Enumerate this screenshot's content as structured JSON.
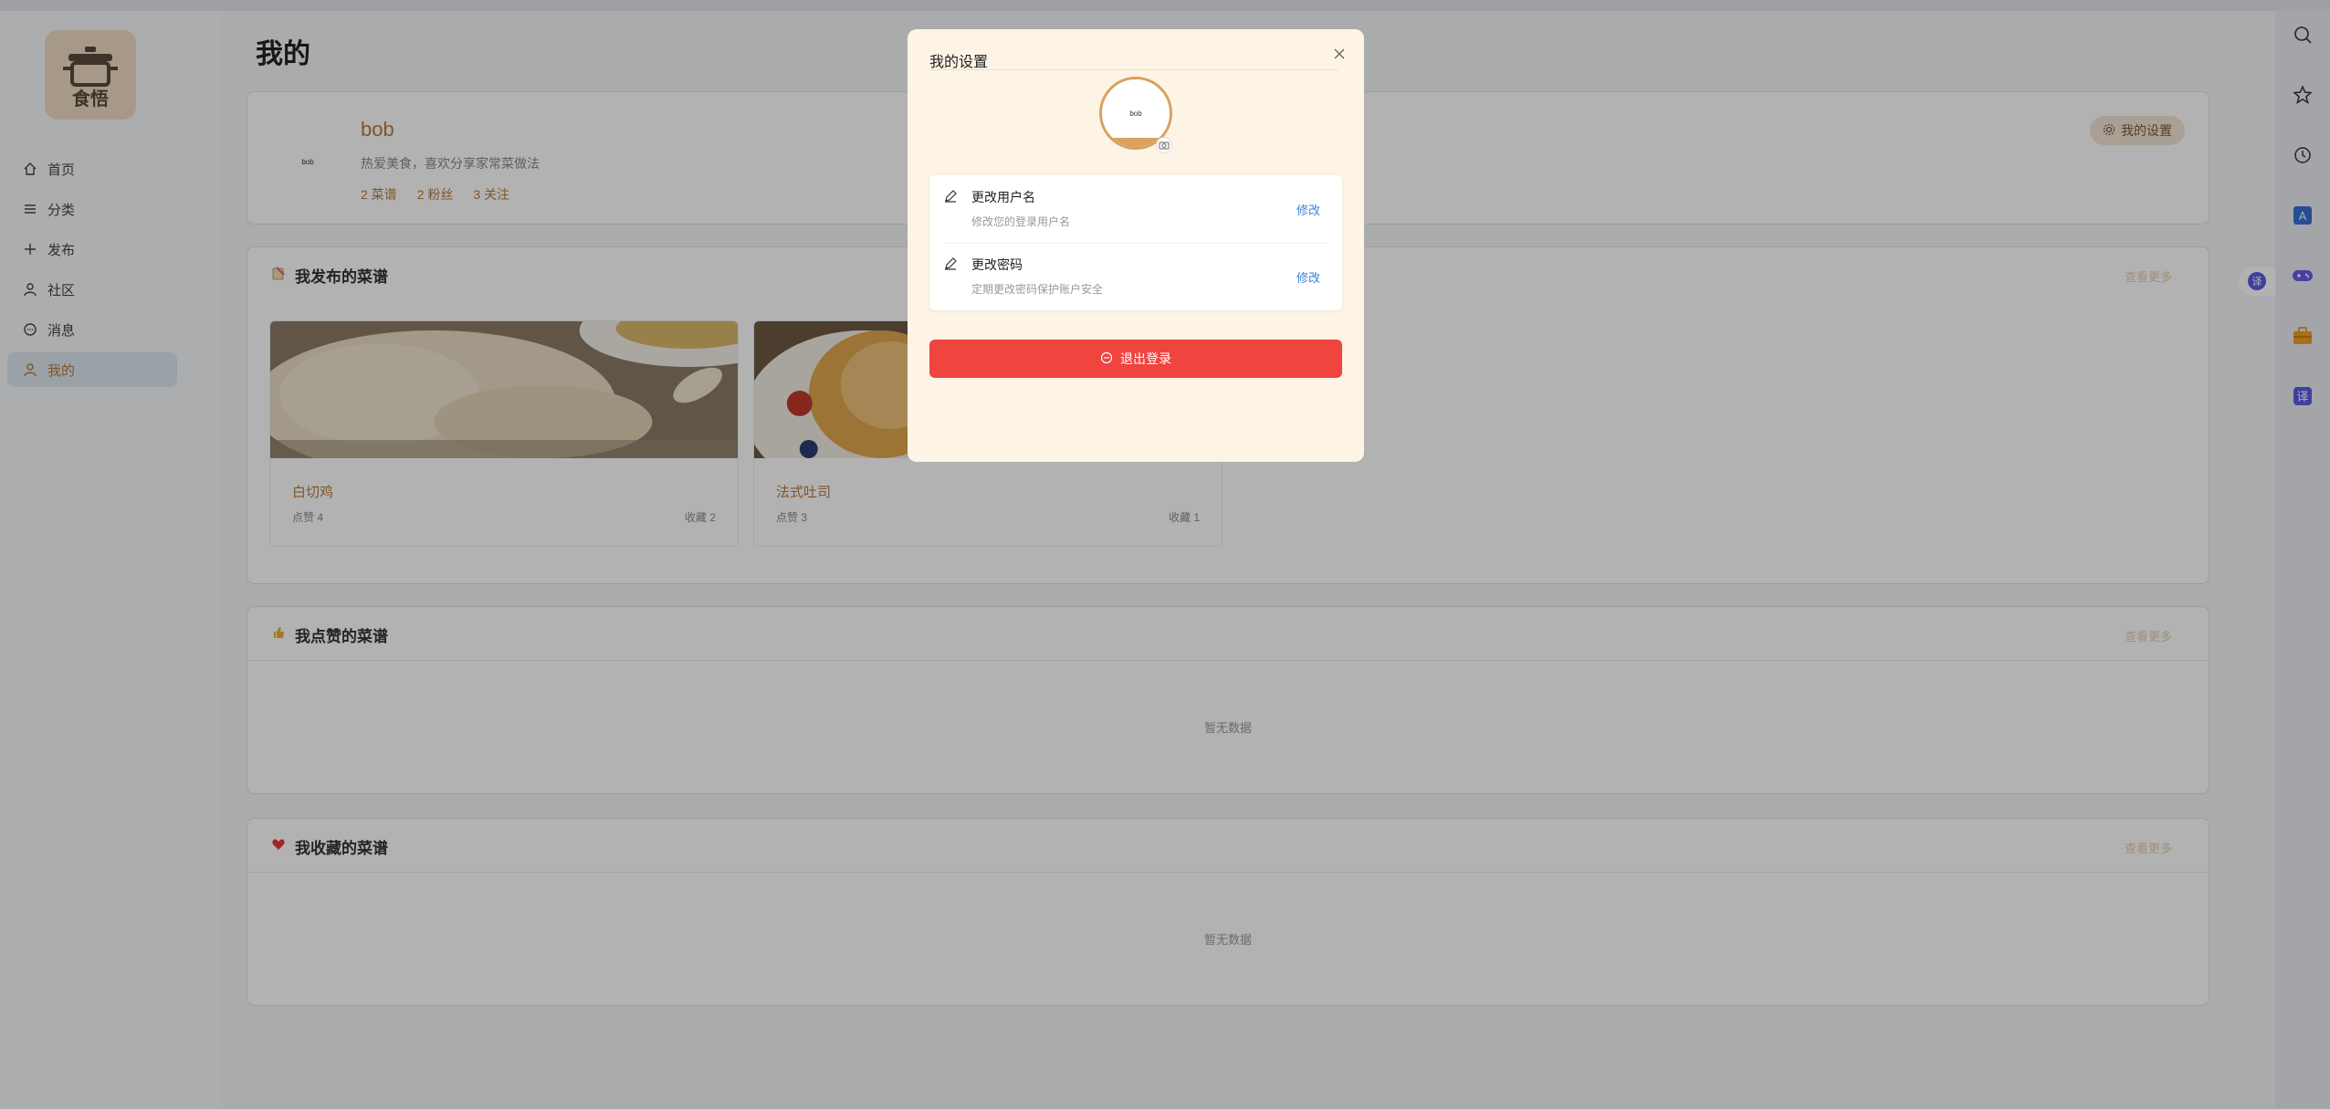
{
  "app": {
    "logo_text": "食悟"
  },
  "nav": {
    "items": [
      {
        "label": "首页",
        "icon": "home-icon"
      },
      {
        "label": "分类",
        "icon": "list-icon"
      },
      {
        "label": "发布",
        "icon": "plus-icon"
      },
      {
        "label": "社区",
        "icon": "user-icon"
      },
      {
        "label": "消息",
        "icon": "message-icon"
      },
      {
        "label": "我的",
        "icon": "user-icon",
        "active": true
      }
    ]
  },
  "page": {
    "title": "我的"
  },
  "profile": {
    "avatar_text": "bob",
    "username": "bob",
    "bio": "热爱美食，喜欢分享家常菜做法",
    "stats": {
      "recipes": "2 菜谱",
      "fans": "2 粉丝",
      "following": "3 关注"
    },
    "settings_label": "我的设置"
  },
  "published": {
    "title": "我发布的菜谱",
    "view_more": "查看更多",
    "recipes": [
      {
        "name": "白切鸡",
        "likes": "点赞 4",
        "favs": "收藏 2"
      },
      {
        "name": "法式吐司",
        "likes": "点赞 3",
        "favs": "收藏 1"
      }
    ]
  },
  "liked": {
    "title": "我点赞的菜谱",
    "view_more": "查看更多",
    "empty": "暂无数据"
  },
  "collected": {
    "title": "我收藏的菜谱",
    "view_more": "查看更多",
    "empty": "暂无数据"
  },
  "modal": {
    "title": "我的设置",
    "avatar_text": "bob",
    "options": [
      {
        "title": "更改用户名",
        "desc": "修改您的登录用户名",
        "action": "修改"
      },
      {
        "title": "更改密码",
        "desc": "定期更改密码保护账户安全",
        "action": "修改"
      }
    ],
    "logout_label": "退出登录"
  },
  "toolbar": {
    "icons": [
      "search-icon",
      "star-icon",
      "history-icon",
      "image-translate-icon",
      "game-icon",
      "toolbox-icon",
      "translate-icon"
    ],
    "float_badge": "译"
  },
  "colors": {
    "accent": "#b47b3c",
    "danger": "#f0443f",
    "link": "#3b82d6",
    "modal_bg": "#fdf4e6"
  }
}
